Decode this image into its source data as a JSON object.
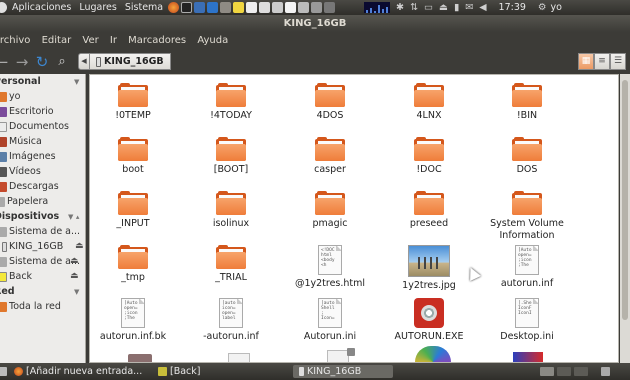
{
  "top_panel": {
    "menus": [
      "Aplicaciones",
      "Lugares",
      "Sistema"
    ],
    "clock": "17:39",
    "user": "yo"
  },
  "window": {
    "title": "KING_16GB"
  },
  "menubar": [
    "Archivo",
    "Editar",
    "Ver",
    "Ir",
    "Marcadores",
    "Ayuda"
  ],
  "toolbar": {
    "location": "KING_16GB"
  },
  "sidebar": {
    "personal_header": "Personal",
    "personal": [
      "yo",
      "Escritorio",
      "Documentos",
      "Música",
      "Imágenes",
      "Vídeos",
      "Descargas",
      "Papelera"
    ],
    "devices_header": "Dispositivos",
    "devices": [
      "Sistema de a...",
      "KING_16GB",
      "Sistema de a...",
      "Back"
    ],
    "network_header": "Red",
    "network": [
      "Toda la red"
    ]
  },
  "files": [
    {
      "name": "!0TEMP",
      "kind": "folder"
    },
    {
      "name": "!4TODAY",
      "kind": "folder"
    },
    {
      "name": "4DOS",
      "kind": "folder"
    },
    {
      "name": "4LNX",
      "kind": "folder"
    },
    {
      "name": "!BIN",
      "kind": "folder"
    },
    {
      "name": "boot",
      "kind": "folder"
    },
    {
      "name": "[BOOT]",
      "kind": "folder"
    },
    {
      "name": "casper",
      "kind": "folder"
    },
    {
      "name": "!DOC",
      "kind": "folder"
    },
    {
      "name": "DOS",
      "kind": "folder"
    },
    {
      "name": "_INPUT",
      "kind": "folder"
    },
    {
      "name": "isolinux",
      "kind": "folder"
    },
    {
      "name": "pmagic",
      "kind": "folder"
    },
    {
      "name": "preseed",
      "kind": "folder"
    },
    {
      "name": "System Volume Information",
      "kind": "folder"
    },
    {
      "name": "_tmp",
      "kind": "folder"
    },
    {
      "name": "_TRIAL",
      "kind": "folder"
    },
    {
      "name": "@1y2tres.html",
      "kind": "doc",
      "preview": "<!DOC\nhtml\n<body\n<h"
    },
    {
      "name": "1y2tres.jpg",
      "kind": "image"
    },
    {
      "name": "autorun.inf",
      "kind": "doc",
      "preview": "[Auto\nopen=\n;icon\n;The"
    },
    {
      "name": "autorun.inf.bk",
      "kind": "doc",
      "preview": "[Auto\nopen=\n;icon\n;The"
    },
    {
      "name": "-autorun.inf",
      "kind": "doc",
      "preview": "[auto\nicon=\nopen=\nlabel"
    },
    {
      "name": "Autorun.ini",
      "kind": "doc",
      "preview": "[auto\nShell\n;\nIcon="
    },
    {
      "name": "AUTORUN.EXE",
      "kind": "exe"
    },
    {
      "name": "Desktop.ini",
      "kind": "doc",
      "preview": "[.She\nIconF\nIconI"
    }
  ],
  "bottom_panel": {
    "tasks": [
      "[Añadir nueva entrada...",
      "[Back]",
      "KING_16GB"
    ]
  }
}
